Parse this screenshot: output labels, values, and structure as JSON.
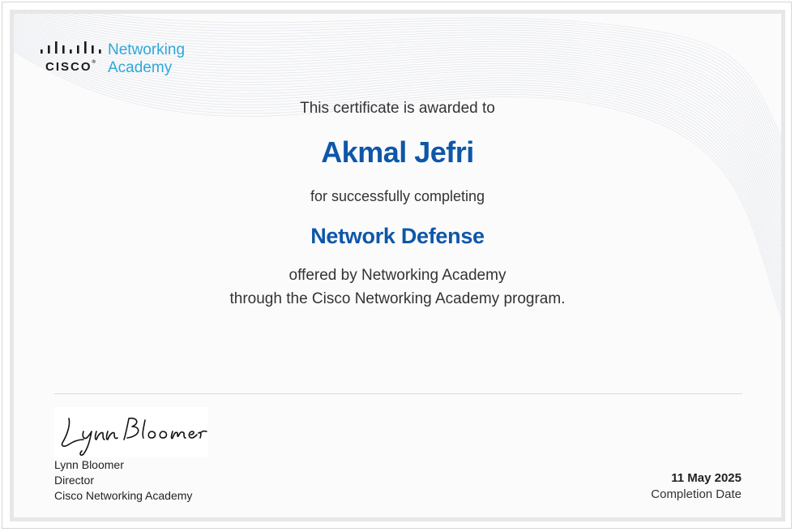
{
  "logo": {
    "brand": "CISCO",
    "program_line1": "Networking",
    "program_line2": "Academy"
  },
  "certificate": {
    "awarded_text": "This certificate is awarded to",
    "recipient_name": "Akmal Jefri",
    "completing_text": "for successfully completing",
    "course_name": "Network Defense",
    "offered_text": "offered by Networking Academy",
    "through_text": "through the Cisco Networking Academy program."
  },
  "signer": {
    "name": "Lynn Bloomer",
    "title": "Director",
    "organization": "Cisco Networking Academy"
  },
  "completion": {
    "date": "11 May 2025",
    "label": "Completion Date"
  },
  "colors": {
    "accent_blue": "#0e57a8",
    "logo_blue": "#2fa8d9",
    "text": "#333333",
    "frame": "#e6e7e9"
  }
}
